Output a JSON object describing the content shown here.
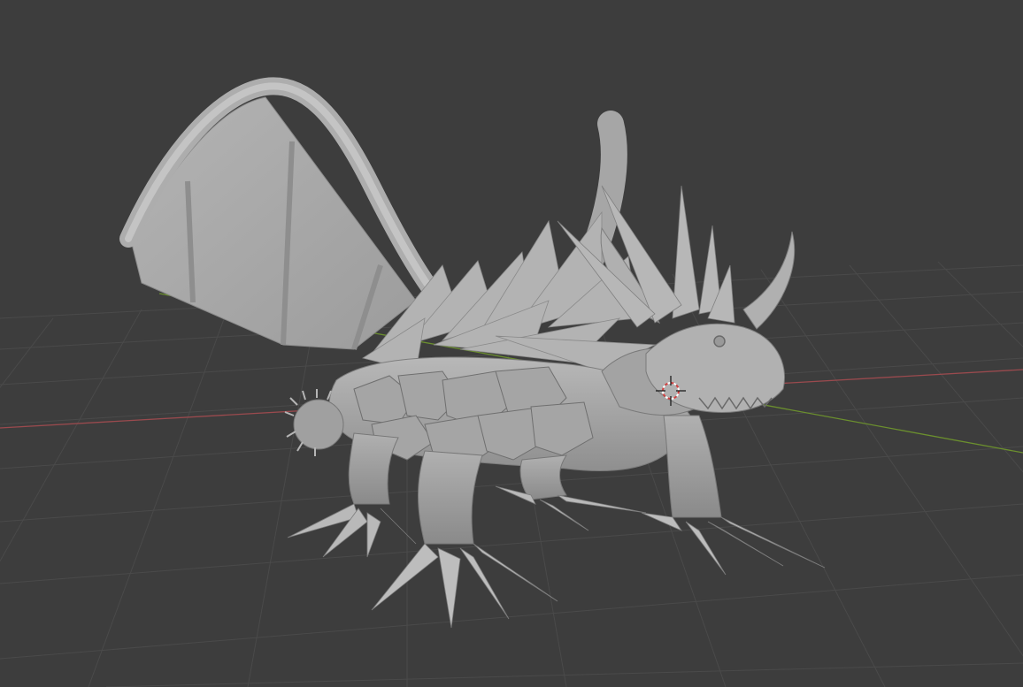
{
  "app": {
    "name": "3D viewport"
  },
  "viewport": {
    "background": "#3d3d3d",
    "grid_color": "#4a4a4a",
    "x_axis_color": "#9a4a4e",
    "y_axis_color": "#6b8f2e",
    "model_color": "#a9a9a9"
  },
  "scene": {
    "object": "dragon-sculpt",
    "shading": "solid",
    "cursor": "3d-cursor"
  }
}
